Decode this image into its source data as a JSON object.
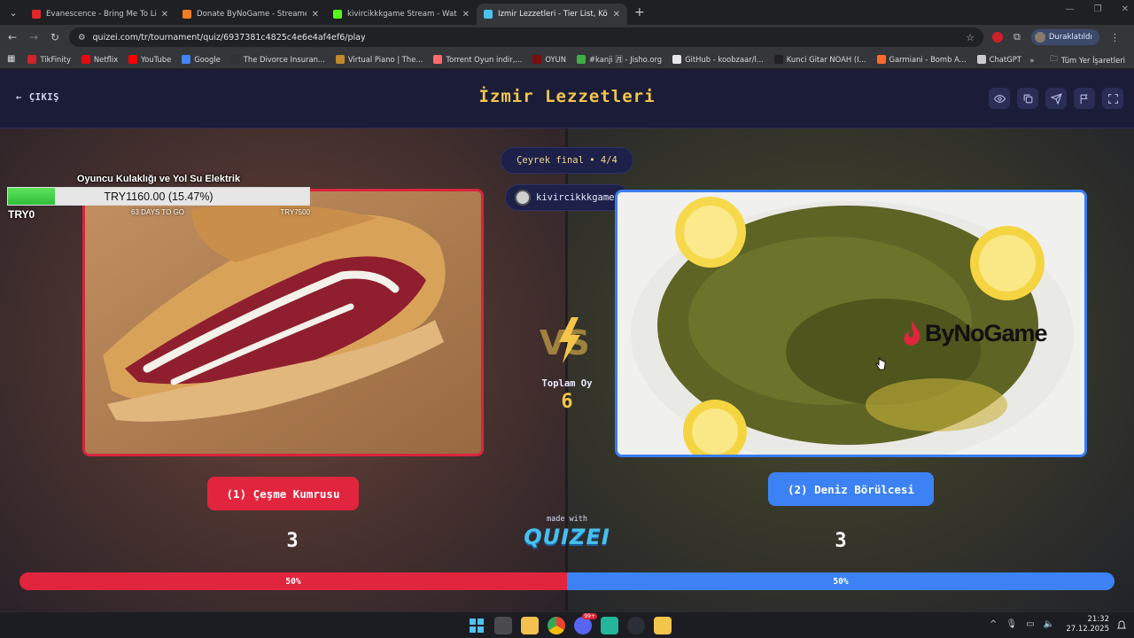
{
  "browser": {
    "tabs": [
      {
        "title": "Evanescence - Bring Me To Life",
        "color": "#e02a2a",
        "active": false
      },
      {
        "title": "Donate ByNoGame - Streamer",
        "color": "#f07c1f",
        "active": false
      },
      {
        "title": "kivircikkkgame Stream - Watch",
        "color": "#53fc18",
        "active": false
      },
      {
        "title": "İzmir Lezzetleri - Tier List, Kör S",
        "color": "#4ac3ef",
        "active": true
      }
    ],
    "url": "quizei.com/tr/tournament/quiz/6937381c4825c4e6e4af4ef6/play",
    "profile_label": "Duraklatıldı",
    "bookmarks": [
      {
        "label": "TikFinity",
        "color": "#d2232a"
      },
      {
        "label": "Netflix",
        "color": "#e50914"
      },
      {
        "label": "YouTube",
        "color": "#ff0000"
      },
      {
        "label": "Google",
        "color": "#4285f4"
      },
      {
        "label": "The Divorce Insuran...",
        "color": "#333333"
      },
      {
        "label": "Virtual Piano | The...",
        "color": "#c08a2d"
      },
      {
        "label": "Torrent Oyun indir,...",
        "color": "#ff6b6b"
      },
      {
        "label": "OYUN",
        "color": "#7a0d0d"
      },
      {
        "label": "#kanji 🈷 - Jisho.org",
        "color": "#3cb044"
      },
      {
        "label": "GitHub - koobzaar/l...",
        "color": "#e6e6e6"
      },
      {
        "label": "Kunci Gitar NOAH (I...",
        "color": "#222222"
      },
      {
        "label": "Garmiani - Bomb A...",
        "color": "#ff6a2b"
      },
      {
        "label": "ChatGPT",
        "color": "#cccccc"
      }
    ],
    "all_bookmarks": "Tüm Yer İşaretleri"
  },
  "header": {
    "exit_label": "ÇIKIŞ",
    "title": "İzmir Lezzetleri"
  },
  "round": {
    "label": "Çeyrek final • 4/4",
    "user": "kivircikkkgame"
  },
  "left": {
    "option": "(1) Çeşme Kumrusu",
    "score": "3",
    "percent": "50%",
    "color": "#e2253e"
  },
  "right": {
    "option": "(2) Deniz Börülcesi",
    "score": "3",
    "percent": "50%",
    "color": "#3c82f5"
  },
  "vote": {
    "total_label": "Toplam Oy",
    "total": "6",
    "share_left": 0.5
  },
  "branding": {
    "made_with": "made with",
    "logo": "QUIZEI",
    "sponsor_logo": "ByNoGame"
  },
  "donation": {
    "title": "Oyuncu Kulaklığı ve Yol Su Elektrik",
    "progress_text": "TRY1160.00 (15.47%)",
    "progress": 0.1547,
    "min_label": "TRY0",
    "days_label": "63 DAYS TO GO",
    "max_label": "TRY7500"
  },
  "taskbar": {
    "time": "21:32",
    "date": "27.12.2025",
    "badge": "99+"
  }
}
